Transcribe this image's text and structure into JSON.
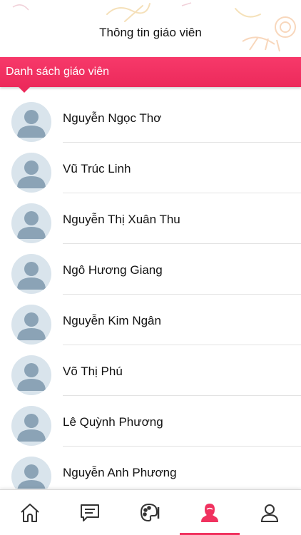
{
  "header": {
    "title": "Thông tin giáo viên"
  },
  "section": {
    "label": "Danh sách giáo viên"
  },
  "teachers": [
    {
      "name": "Nguyễn Ngọc Thơ"
    },
    {
      "name": "Vũ Trúc Linh"
    },
    {
      "name": "Nguyễn Thị Xuân Thu"
    },
    {
      "name": "Ngô Hương Giang"
    },
    {
      "name": "Nguyễn Kim Ngân"
    },
    {
      "name": "Võ Thị Phú"
    },
    {
      "name": "Lê Quỳnh Phương"
    },
    {
      "name": "Nguyễn Anh Phương"
    }
  ],
  "tabs": [
    {
      "icon": "home-icon",
      "active": false
    },
    {
      "icon": "message-icon",
      "active": false
    },
    {
      "icon": "palette-icon",
      "active": false
    },
    {
      "icon": "teacher-icon",
      "active": true
    },
    {
      "icon": "profile-icon",
      "active": false
    }
  ],
  "colors": {
    "accent": "#f0325f",
    "avatar_bg": "#d9e4ec",
    "avatar_fg": "#8ba3b6",
    "icon_gray": "#333333"
  }
}
